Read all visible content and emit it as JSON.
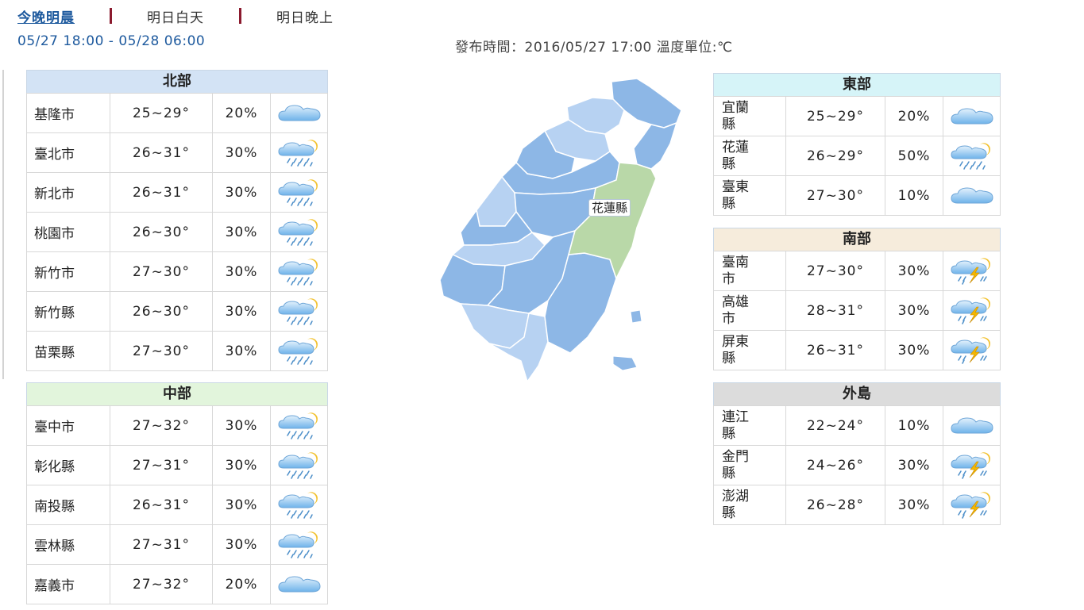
{
  "tabs": [
    {
      "label": "今晚明晨",
      "active": true
    },
    {
      "label": "明日白天",
      "active": false
    },
    {
      "label": "明日晚上",
      "active": false
    }
  ],
  "period": "05/27 18:00 - 05/28 06:00",
  "publish": "發布時間：2016/05/27 17:00 溫度單位:℃",
  "map": {
    "highlight_label": "花蓮縣",
    "highlight_color": "#b9d8a8",
    "base_color": "#8db7e6",
    "light_color": "#b7d2f2"
  },
  "regions": {
    "north": {
      "name": "北部",
      "head_color": "#d3e3f5",
      "rows": [
        {
          "city": "基隆市",
          "temp": "25~29°",
          "rain": "20%",
          "icon": "cloudy-icon"
        },
        {
          "city": "臺北市",
          "temp": "26~31°",
          "rain": "30%",
          "icon": "cloudy-showers-icon"
        },
        {
          "city": "新北市",
          "temp": "26~31°",
          "rain": "30%",
          "icon": "cloudy-showers-icon"
        },
        {
          "city": "桃園市",
          "temp": "26~30°",
          "rain": "30%",
          "icon": "cloudy-showers-icon"
        },
        {
          "city": "新竹市",
          "temp": "27~30°",
          "rain": "30%",
          "icon": "cloudy-showers-icon"
        },
        {
          "city": "新竹縣",
          "temp": "26~30°",
          "rain": "30%",
          "icon": "cloudy-showers-icon"
        },
        {
          "city": "苗栗縣",
          "temp": "27~30°",
          "rain": "30%",
          "icon": "cloudy-showers-icon"
        }
      ]
    },
    "central": {
      "name": "中部",
      "head_color": "#e2f5dc",
      "rows": [
        {
          "city": "臺中市",
          "temp": "27~32°",
          "rain": "30%",
          "icon": "cloudy-showers-icon"
        },
        {
          "city": "彰化縣",
          "temp": "27~31°",
          "rain": "30%",
          "icon": "cloudy-showers-icon"
        },
        {
          "city": "南投縣",
          "temp": "26~31°",
          "rain": "30%",
          "icon": "cloudy-showers-icon"
        },
        {
          "city": "雲林縣",
          "temp": "27~31°",
          "rain": "30%",
          "icon": "cloudy-showers-icon"
        },
        {
          "city": "嘉義市",
          "temp": "27~32°",
          "rain": "20%",
          "icon": "cloudy-icon"
        }
      ]
    },
    "east": {
      "name": "東部",
      "head_color": "#d6f4f8",
      "rows": [
        {
          "city": "宜蘭縣",
          "temp": "25~29°",
          "rain": "20%",
          "icon": "cloudy-icon"
        },
        {
          "city": "花蓮縣",
          "temp": "26~29°",
          "rain": "50%",
          "icon": "cloudy-showers-icon"
        },
        {
          "city": "臺東縣",
          "temp": "27~30°",
          "rain": "10%",
          "icon": "cloudy-icon"
        }
      ]
    },
    "south": {
      "name": "南部",
      "head_color": "#f6ecdc",
      "rows": [
        {
          "city": "臺南市",
          "temp": "27~30°",
          "rain": "30%",
          "icon": "thunderstorm-icon"
        },
        {
          "city": "高雄市",
          "temp": "28~31°",
          "rain": "30%",
          "icon": "thunderstorm-icon"
        },
        {
          "city": "屏東縣",
          "temp": "26~31°",
          "rain": "30%",
          "icon": "thunderstorm-icon"
        }
      ]
    },
    "islands": {
      "name": "外島",
      "head_color": "#dcdcdc",
      "rows": [
        {
          "city": "連江縣",
          "temp": "22~24°",
          "rain": "10%",
          "icon": "cloudy-icon"
        },
        {
          "city": "金門縣",
          "temp": "24~26°",
          "rain": "30%",
          "icon": "thunderstorm-icon"
        },
        {
          "city": "澎湖縣",
          "temp": "26~28°",
          "rain": "30%",
          "icon": "thunderstorm-icon"
        }
      ]
    }
  }
}
